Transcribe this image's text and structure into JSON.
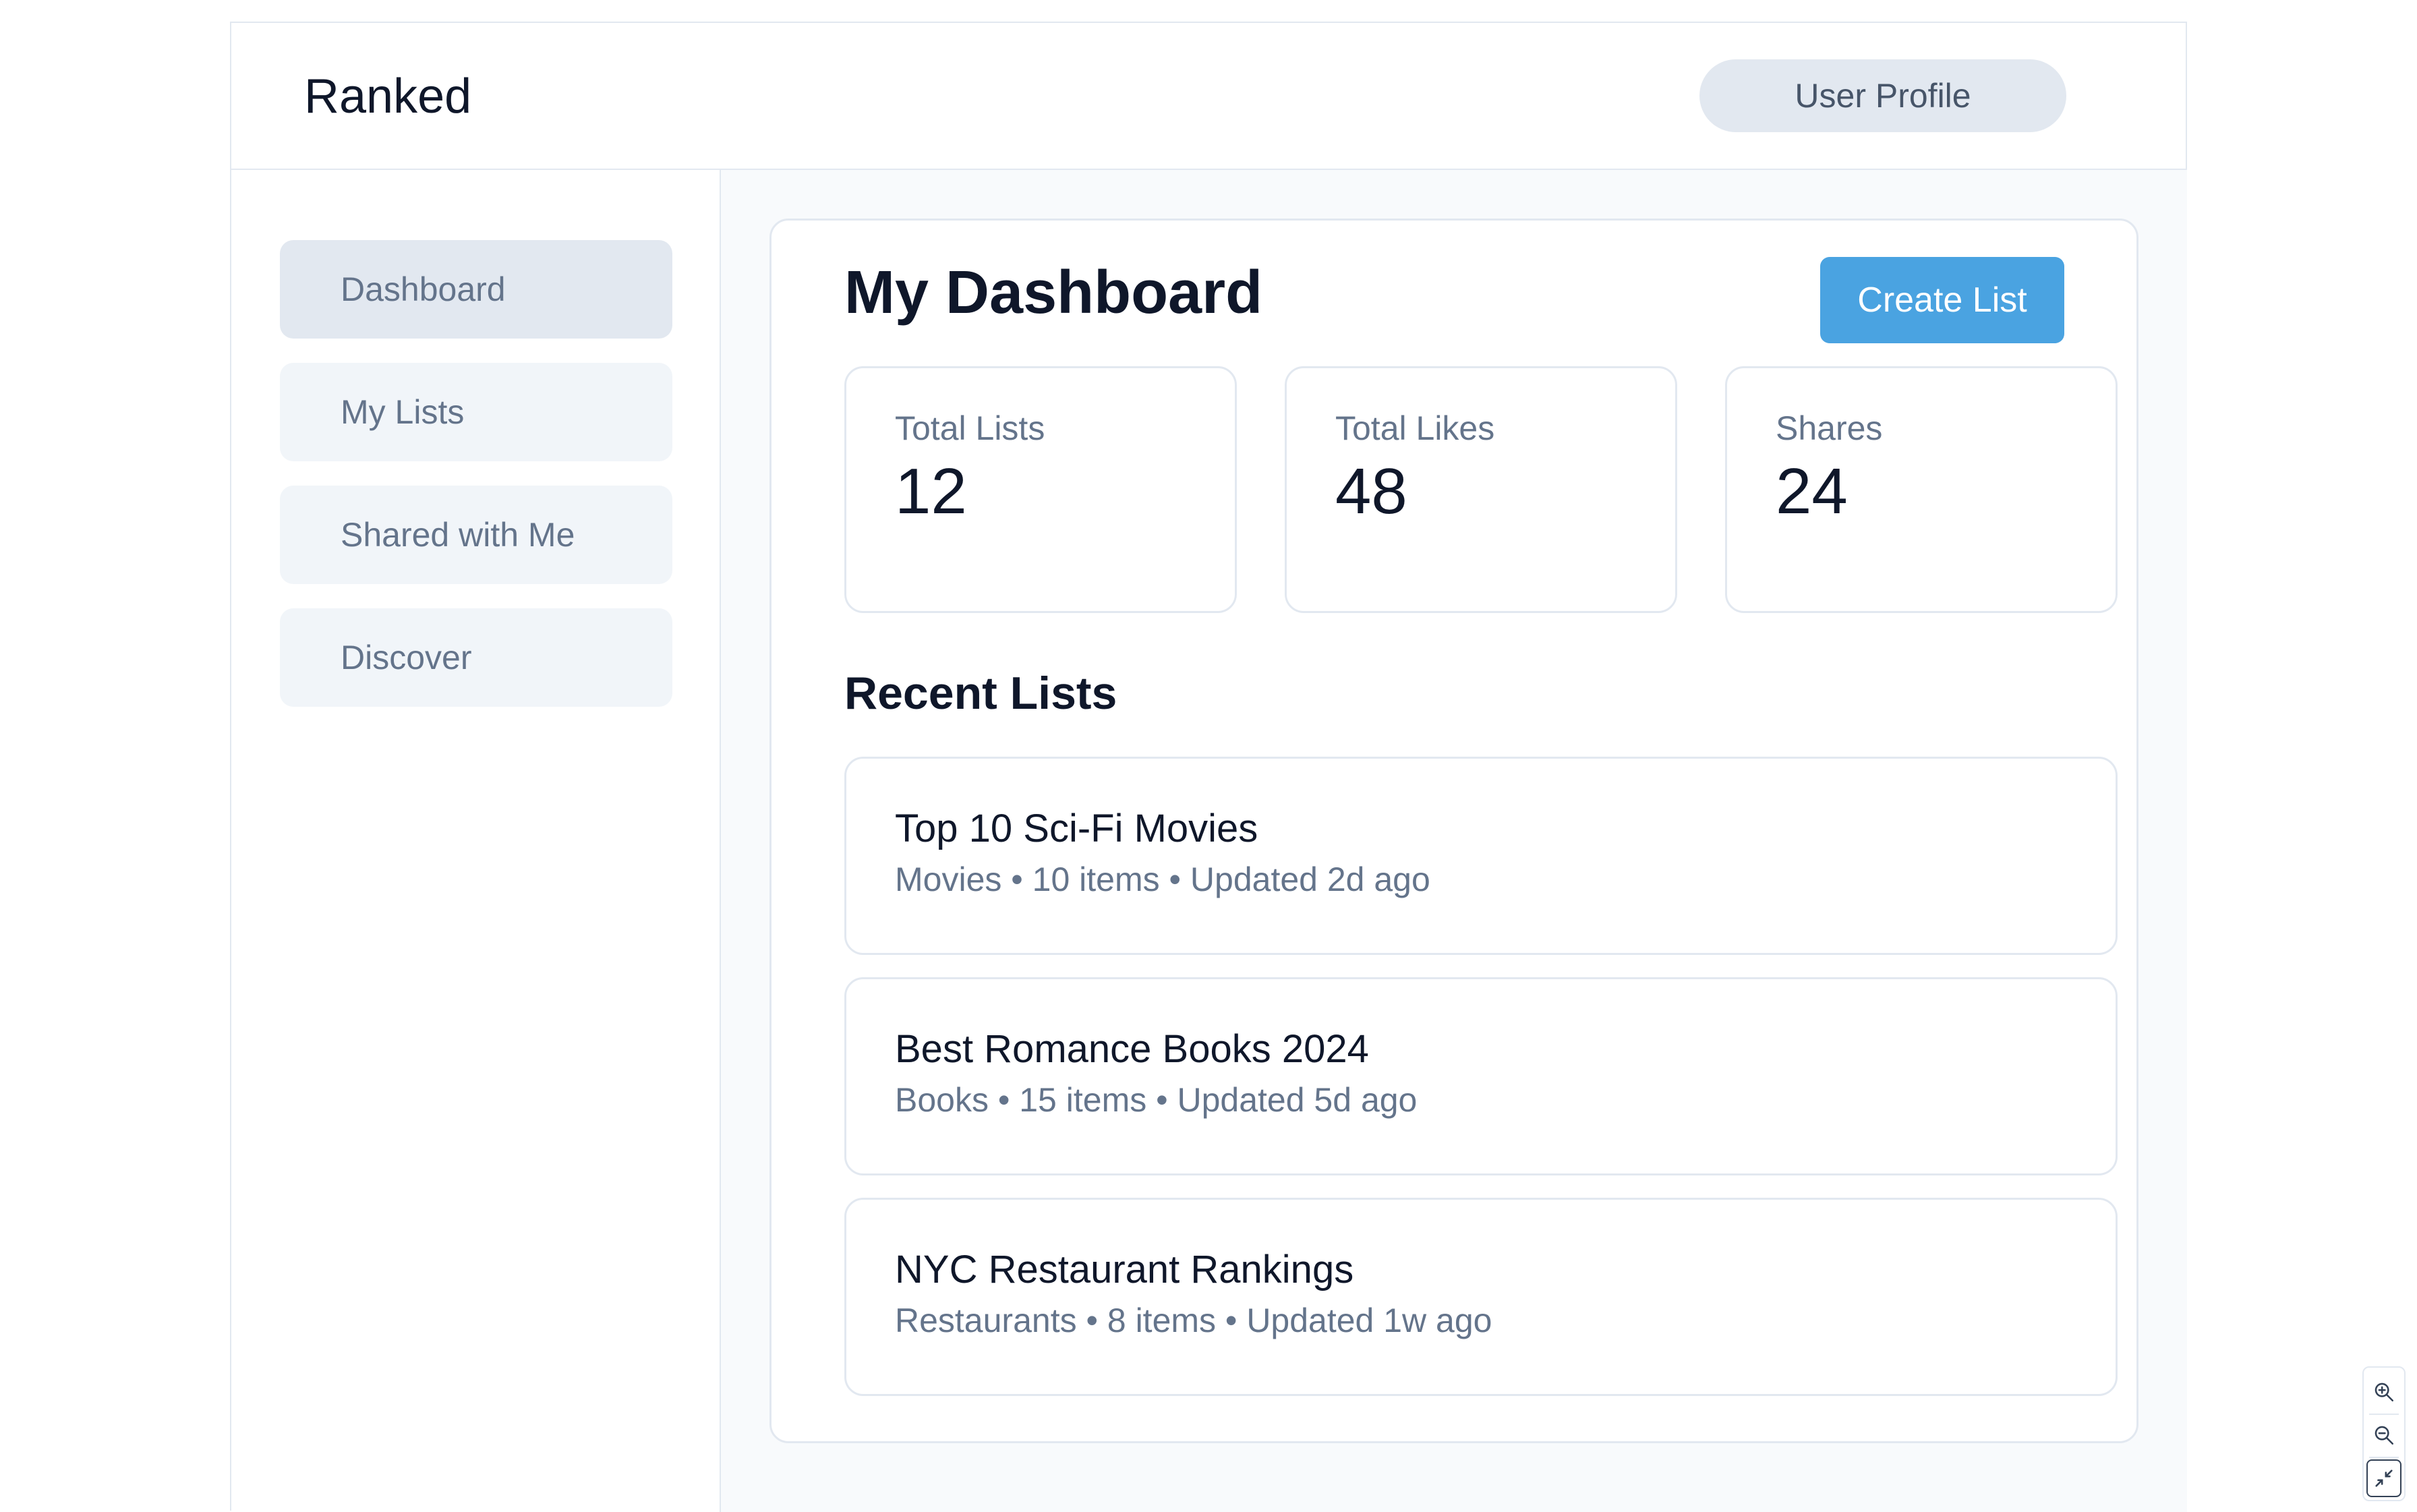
{
  "header": {
    "brand": "Ranked",
    "profile_label": "User Profile"
  },
  "sidebar": {
    "items": [
      {
        "label": "Dashboard",
        "active": true
      },
      {
        "label": "My Lists",
        "active": false
      },
      {
        "label": "Shared with Me",
        "active": false
      },
      {
        "label": "Discover",
        "active": false
      }
    ]
  },
  "main": {
    "title": "My Dashboard",
    "create_label": "Create List",
    "stats": [
      {
        "label": "Total Lists",
        "value": "12"
      },
      {
        "label": "Total Likes",
        "value": "48"
      },
      {
        "label": "Shares",
        "value": "24"
      }
    ],
    "recent_title": "Recent Lists",
    "recent": [
      {
        "title": "Top 10 Sci-Fi Movies",
        "meta": "Movies • 10 items • Updated 2d ago"
      },
      {
        "title": "Best Romance Books 2024",
        "meta": "Books • 15 items • Updated 5d ago"
      },
      {
        "title": "NYC Restaurant Rankings",
        "meta": "Restaurants • 8 items • Updated 1w ago"
      }
    ]
  },
  "colors": {
    "accent": "#4aa3e1",
    "text_primary": "#0f172a",
    "text_muted": "#64748b",
    "border": "#e2e8f0",
    "nav_bg": "#f1f5f9",
    "nav_active_bg": "#e2e8f0"
  },
  "icons": {
    "zoom_in": "zoom-in-icon",
    "zoom_out": "zoom-out-icon",
    "fit": "collapse-icon"
  }
}
